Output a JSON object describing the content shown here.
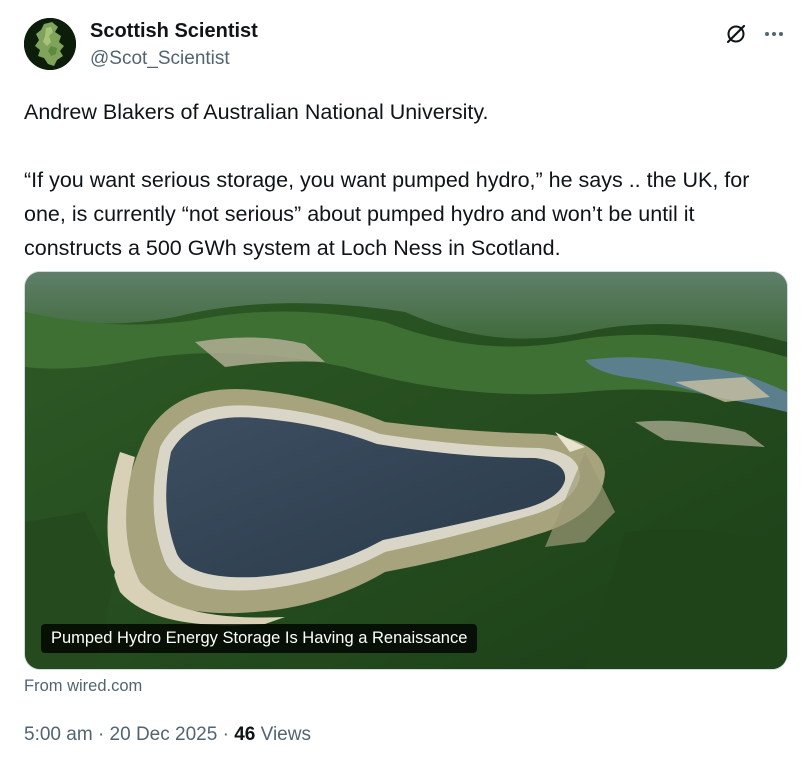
{
  "author": {
    "name": "Scottish Scientist",
    "handle": "@Scot_Scientist"
  },
  "tweet": {
    "text": "Andrew Blakers of Australian National University.\n\n“If you want serious storage, you want pumped hydro,” he says .. the UK, for one, is currently “not serious” about pumped hydro and won’t be until it constructs a 500 GWh system at Loch Ness in Scotland."
  },
  "card": {
    "title": "Pumped Hydro Energy Storage Is Having a Renaissance",
    "source": "From wired.com"
  },
  "meta": {
    "time": "5:00 am",
    "separator": "·",
    "date": "20 Dec 2025",
    "views_count": "46",
    "views_label": "Views"
  },
  "icons": {
    "grok": "grok-icon",
    "more": "more-icon"
  },
  "colors": {
    "text_primary": "#0f1419",
    "text_secondary": "#536471"
  }
}
